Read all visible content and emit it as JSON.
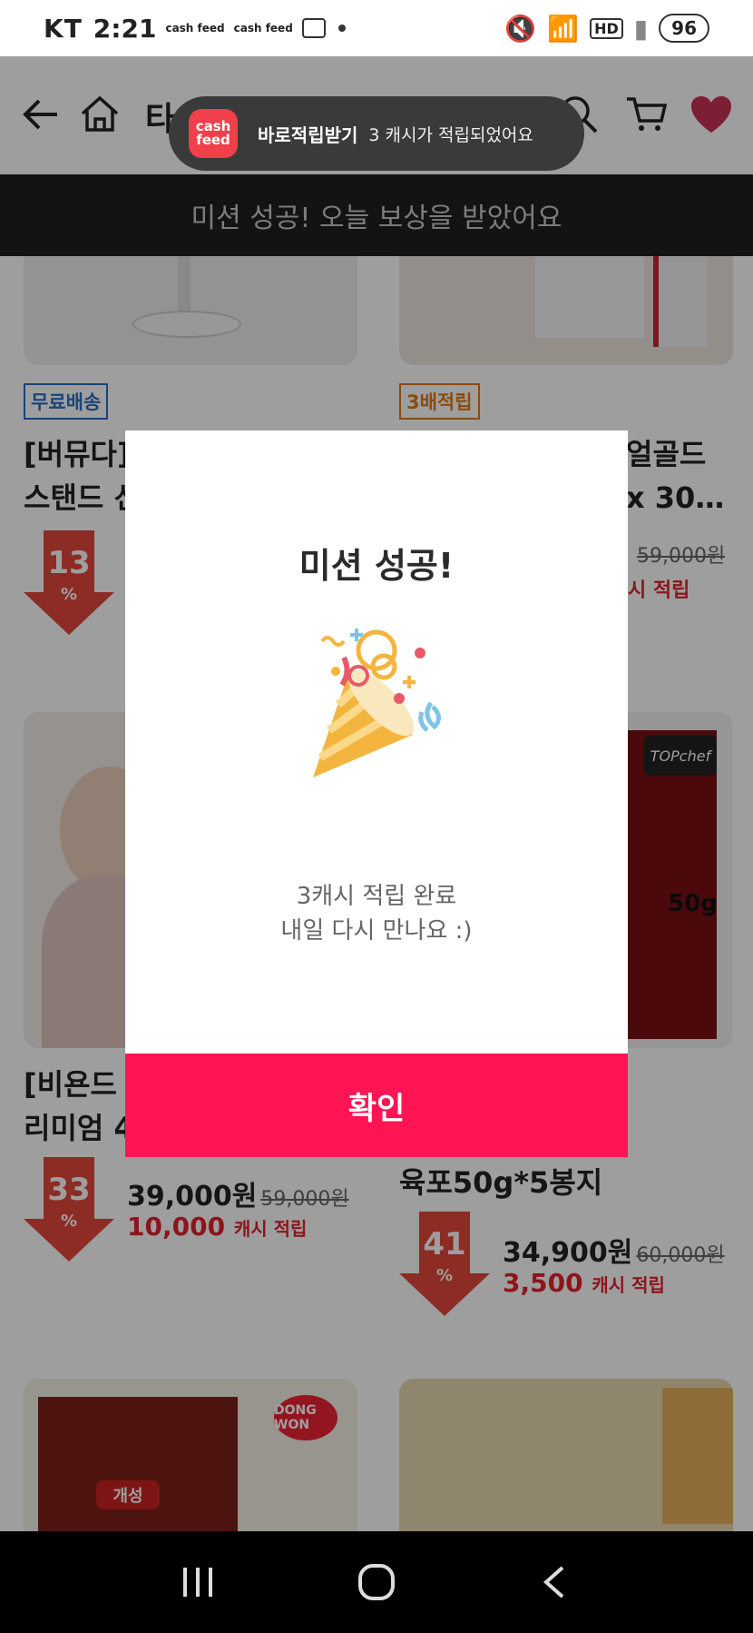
{
  "status_bar": {
    "carrier": "KT",
    "time": "2:21",
    "notif_icon_1": "cash feed",
    "notif_icon_2": "cash feed",
    "battery": "96"
  },
  "app_header": {
    "title": "타",
    "back_icon": "arrow-left-icon",
    "home_icon": "home-icon",
    "search_icon": "search-icon",
    "cart_icon": "cart-icon",
    "heart_icon": "heart-icon"
  },
  "toast": {
    "logo_line1": "cash",
    "logo_line2": "feed",
    "title": "바로적립받기",
    "message": "3 캐시가 적립되었어요"
  },
  "mission_banner": {
    "text": "미션 성공! 오늘 보상을 받았어요"
  },
  "products": [
    {
      "badge": "무료배송",
      "title": "[버뮤다]\n스탠드 선",
      "discount": "13",
      "pct": "%"
    },
    {
      "badge": "3배적립",
      "title": "얼골드\nx 30…",
      "original_price": "59,000원",
      "points_prefix": "시 적립"
    },
    {
      "title": "[비욘드\n리미엄 4",
      "discount": "33",
      "pct": "%",
      "price": "39,000원",
      "original_price": "59,000원",
      "points": "10,000",
      "points_label": "캐시 적립"
    },
    {
      "title": "고기\n육포50g*5봉지",
      "discount": "41",
      "pct": "%",
      "price": "34,900원",
      "original_price": "60,000원",
      "points": "3,500",
      "points_label": "캐시 적립",
      "image_brand": "TOPchef",
      "image_weight": "50g"
    },
    {
      "image_brand": "DONG WON",
      "image_text": "개성"
    },
    {}
  ],
  "modal": {
    "title": "미션 성공!",
    "line1": "3캐시 적립 완료",
    "line2": "내일 다시 만나요 :)",
    "confirm": "확인",
    "illustration_icon": "party-popper-icon"
  },
  "nav_bar": {
    "recents_icon": "recents-icon",
    "home_icon": "home-circle-icon",
    "back_icon": "back-chevron-icon"
  }
}
